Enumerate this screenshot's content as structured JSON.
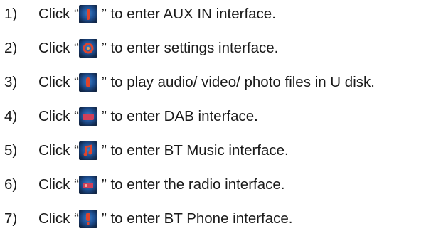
{
  "items": [
    {
      "num": "1)",
      "prefix": "Click “",
      "icon": "aux-in-icon",
      "suffix": "” to enter AUX IN interface."
    },
    {
      "num": "2)",
      "prefix": "Click “",
      "icon": "settings-icon",
      "suffix": "” to enter settings interface."
    },
    {
      "num": "3)",
      "prefix": "Click “",
      "icon": "usb-icon",
      "suffix": "” to play audio/ video/ photo files in U disk."
    },
    {
      "num": "4)",
      "prefix": "Click “",
      "icon": "dab-icon",
      "suffix": "” to enter DAB interface."
    },
    {
      "num": "5)",
      "prefix": "Click “",
      "icon": "bt-music-icon",
      "suffix": "” to enter BT Music interface."
    },
    {
      "num": "6)",
      "prefix": "Click “",
      "icon": "radio-icon",
      "suffix": "” to enter the radio interface."
    },
    {
      "num": "7)",
      "prefix": "Click “",
      "icon": "bt-phone-icon",
      "suffix": "” to enter BT Phone interface."
    }
  ],
  "colors": {
    "text": "#1a1a1a",
    "icon_bg": "#1e4f92",
    "icon_glyph": "#e0442b"
  }
}
